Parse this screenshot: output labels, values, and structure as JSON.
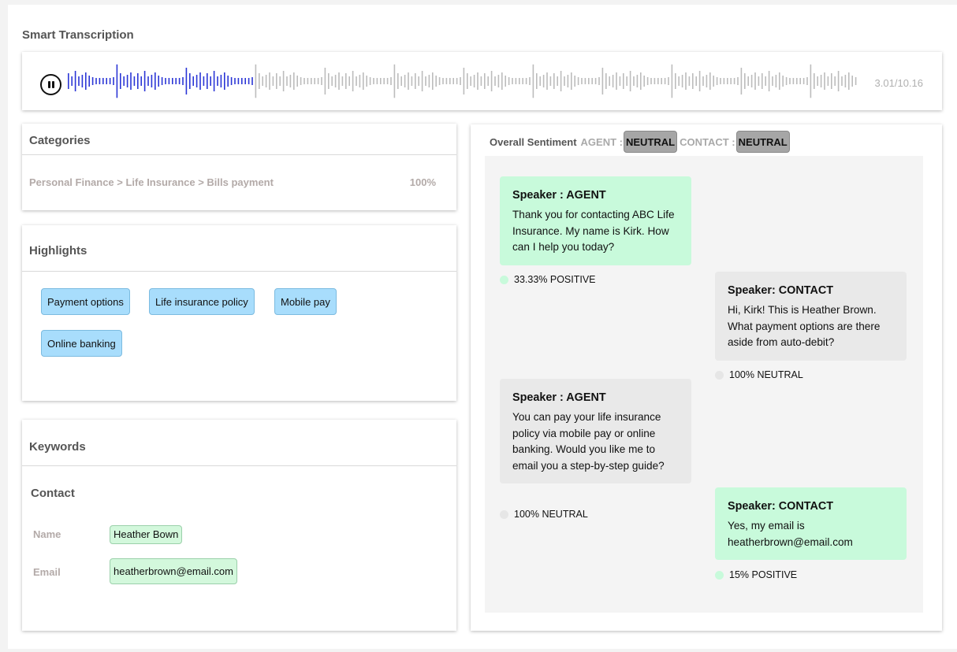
{
  "app_title": "Smart Transcription",
  "player": {
    "time": "3.01/10.16",
    "progress_fraction": 0.235,
    "played_color": "#2b36d6",
    "unplayed_color": "#bcbcbc",
    "icon": "pause-icon"
  },
  "categories": {
    "title": "Categories",
    "items": [
      {
        "path": "Personal Finance > Life Insurance > Bills payment",
        "percent": "100%"
      }
    ]
  },
  "highlights": {
    "title": "Highlights",
    "chips": [
      "Payment options",
      "Life insurance policy",
      "Mobile pay",
      "Online banking"
    ]
  },
  "keywords": {
    "title": "Keywords",
    "subtitle": "Contact",
    "fields": [
      {
        "label": "Name",
        "value": "Heather Bown"
      },
      {
        "label": "Email",
        "value": "heatherbrown@email.com"
      }
    ]
  },
  "sentiment": {
    "title": "Overall Sentiment",
    "agent_label": "AGENT :",
    "agent_value": "NEUTRAL",
    "contact_label": "CONTACT :",
    "contact_value": "NEUTRAL"
  },
  "messages": [
    {
      "speaker": "Speaker : AGENT",
      "text": "Thank you for contacting ABC Life Insurance. My name is Kirk. How can I help you today?",
      "score": "33.33% POSITIVE",
      "tone": "positive"
    },
    {
      "speaker": "Speaker: CONTACT",
      "text": "Hi, Kirk! This is Heather Brown. What payment options are there aside from auto-debit?",
      "score": "100% NEUTRAL",
      "tone": "neutral"
    },
    {
      "speaker": "Speaker : AGENT",
      "text": "You can pay your life insurance policy via mobile pay or online banking. Would you like me to email you a step-by-step guide?",
      "score": "100% NEUTRAL",
      "tone": "neutral"
    },
    {
      "speaker": "Speaker: CONTACT",
      "text": "Yes, my email is heatherbrown@email.com",
      "score": "15% POSITIVE",
      "tone": "positive"
    }
  ]
}
